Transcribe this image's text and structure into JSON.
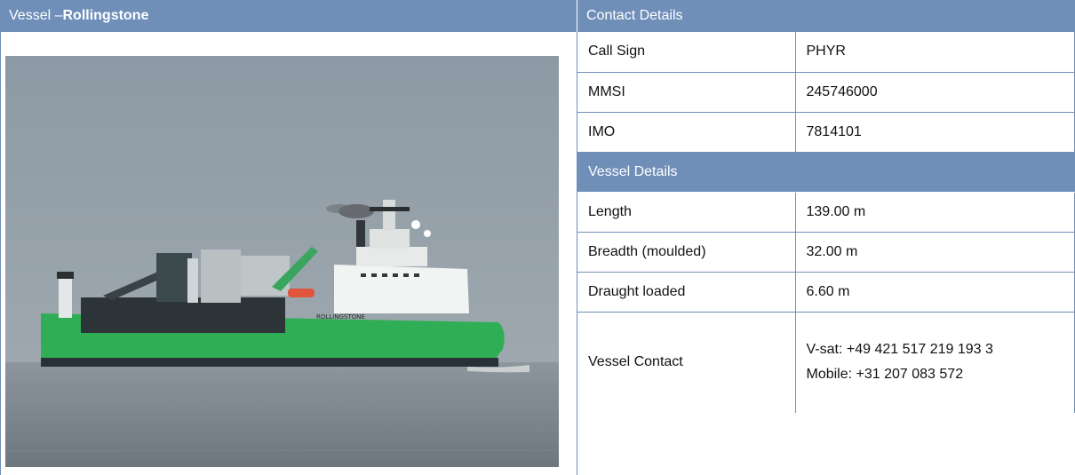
{
  "left_header": {
    "prefix": "Vessel – ",
    "name": "Rollingstone"
  },
  "right_header": {
    "title": "Contact Details"
  },
  "photo": {
    "ship_name_on_hull": "ROLLINGSTONE",
    "hull_color": "#2fae55"
  },
  "contact": [
    {
      "label": "Call Sign",
      "value": "PHYR"
    },
    {
      "label": "MMSI",
      "value": "245746000"
    },
    {
      "label": "IMO",
      "value": "7814101"
    }
  ],
  "vessel_details": {
    "title": "Vessel Details",
    "rows": [
      {
        "label": "Length",
        "value": "139.00 m"
      },
      {
        "label": "Breadth (moulded)",
        "value": "32.00 m"
      },
      {
        "label": "Draught loaded",
        "value": "6.60 m"
      }
    ],
    "vessel_contact": {
      "label": "Vessel Contact",
      "vsat": "V-sat: +49 421 517 219 193 3",
      "mobile": "Mobile: +31 207 083 572"
    }
  },
  "colors": {
    "header": "#6f8fb9",
    "border": "#6f8fb9"
  }
}
